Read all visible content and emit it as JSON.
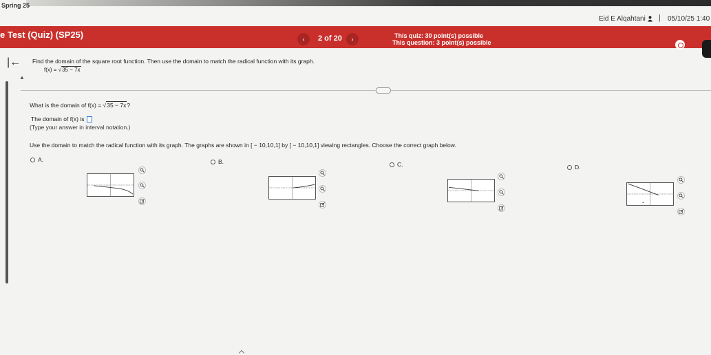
{
  "header": {
    "course": "Spring 25",
    "user_name": "Eid E Alqahtani",
    "separator": "|",
    "datetime": "05/10/25 1:40",
    "user_icon": "person-icon"
  },
  "quiz_bar": {
    "title": "e Test (Quiz) (SP25)",
    "pager": "2 of 20",
    "prev_icon": "‹",
    "next_icon": "›",
    "points_possible": "This quiz: 30 point(s) possible",
    "question_points": "This question: 3 point(s) possible",
    "settings_icon": "gear-icon",
    "accent_color": "#c9302c"
  },
  "question": {
    "back_icon": "|←",
    "prompt": "Find the domain of the square root function. Then use the domain to match the radical function with its graph.",
    "func_lhs": "f(x) = ",
    "func_radicand": "35 − 7x",
    "domain_q_prefix": "What is the domain of ",
    "domain_q_func": "f(x) = ",
    "domain_q_radicand": "35 − 7x",
    "domain_q_suffix": "?",
    "domain_answer_prefix": "The domain of f(x) is",
    "hint": "(Type your answer in interval notation.)",
    "match_prompt_a": "Use the domain to match the radical function with its graph. The graphs are shown in ",
    "match_window_x": "[ − 10,10,1]",
    "match_by": " by ",
    "match_window_y": "[ − 10,10,1]",
    "match_prompt_b": " viewing rectangles. Choose the correct graph below."
  },
  "options": [
    {
      "label": "A."
    },
    {
      "label": "B."
    },
    {
      "label": "C."
    },
    {
      "label": "D."
    }
  ]
}
